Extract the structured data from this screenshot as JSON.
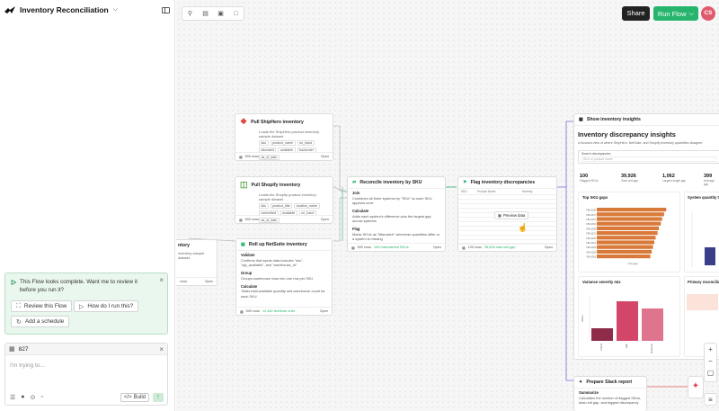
{
  "app": {
    "title": "Inventory Reconciliation"
  },
  "notice": {
    "message": "This Flow looks complete. Want me to review it before you run it?",
    "review": "Review this Flow",
    "howto": "How do I run this?",
    "schedule": "Add a schedule"
  },
  "input": {
    "chip": "827",
    "placeholder": "I'm trying to...",
    "build": "Build"
  },
  "header": {
    "share": "Share",
    "run": "Run Flow",
    "avatar": "CS"
  },
  "nodes": {
    "shiphero": {
      "title": "Pull ShipHero inventory",
      "desc": "Loads the ShipHero product inventory sample dataset",
      "tags": [
        "sku",
        "product_name",
        "on_hand",
        "allocated",
        "available",
        "backorder",
        "as_of_date"
      ],
      "rows": "500 rows",
      "open": "Open"
    },
    "shopify": {
      "title": "Pull Shopify inventory",
      "desc": "Loads the Shopify product inventory sample dataset",
      "tags": [
        "sku",
        "product_title",
        "location_name",
        "committed",
        "available",
        "on_hand",
        "as_of_date"
      ],
      "rows": "500 rows",
      "open": "Open"
    },
    "netsuite": {
      "title": "Roll up NetSuite inventory",
      "s1": "Validate",
      "s1d": "Confirms that inputs data includes \"sku\", \"qty_available\", and \"warehouse_id\"",
      "s2": "Group",
      "s2d": "Groups warehouse rows into one row per SKU",
      "s3": "Calculate",
      "s3d": "Totals total available quantity and warehouse count for each SKU",
      "rows": "500 rows",
      "rows2": "10,482 NetSuite units",
      "open": "Open"
    },
    "partial": {
      "title": "ntory",
      "desc": "nventory sample dataset",
      "rows": "rows",
      "open": "Open"
    },
    "reconcile": {
      "title": "Reconcile inventory by SKU",
      "s1": "Join",
      "s1d": "Combines all three systems by \"SKU\" so each SKU appears once",
      "s2": "Calculate",
      "s2d": "Adds each system's difference plus the largest gap across systems",
      "s3": "Flag",
      "s3d": "Marks SKUs as \"Mismatch\" whenever quantities differ or a system is missing",
      "rows": "500 rows",
      "rows2": "163 mismatched SKUs",
      "open": "Open"
    },
    "flag": {
      "title": "Flag inventory discrepancies",
      "preview": "Preview data",
      "col1": "SKU",
      "col2": "Product Name",
      "col3": "Severity",
      "rows": "100 rows",
      "rows2": "36,628 total unit gap",
      "open": "Open"
    },
    "insights": {
      "node_title": "Show inventory insights",
      "heading": "Inventory discrepancy insights",
      "sub": "A focused view of where ShipHero, NetSuite, and Shopify inventory quantities disagree.",
      "search_label": "Search discrepancies",
      "search_ph": "SKU or product name",
      "k1": "100",
      "k1l": "Flagged SKUs",
      "k2": "39,926",
      "k2l": "Total unit gap",
      "k3": "1,062",
      "k3l": "Largest single gap",
      "k4": "399",
      "k4l": "Average gap",
      "c1": "Top SKU gaps",
      "c1x": "Unit gap",
      "c2": "System quantity totals",
      "c3": "Variance severity mix",
      "c3y": "SKUs",
      "c4": "Primary reconciliati"
    },
    "slack": {
      "title": "Prepare Slack report",
      "s1": "Summarize",
      "s1d": "Calculates the number of flagged SKUs, total unit gap, and biggest discrepancy"
    }
  },
  "chart_data": [
    {
      "type": "bar",
      "title": "Top SKU gaps",
      "xlabel": "Unit gap",
      "categories": [
        "FBI-1040",
        "FBI-1027",
        "FBI-1015",
        "FBI-1033",
        "FBI-1008",
        "FBI-1021",
        "FBI-1046",
        "FBI-1012",
        "FBI-1039",
        "FBI-1004",
        "FBI-1018"
      ],
      "values": [
        1062,
        1030,
        1000,
        980,
        950,
        930,
        900,
        880,
        860,
        840,
        820
      ],
      "xlim": [
        0,
        1100
      ]
    },
    {
      "type": "bar",
      "title": "Variance severity mix",
      "ylabel": "SKUs",
      "categories": [
        "Critical",
        "High",
        "Moderate"
      ],
      "values": [
        14,
        44,
        36
      ],
      "ylim": [
        0,
        50
      ]
    }
  ],
  "colors": {
    "accent": "#27b56d",
    "bar_orange": "#d97a3a",
    "bar_pink": "#d4456a",
    "bar_dark": "#8e2c4a"
  }
}
